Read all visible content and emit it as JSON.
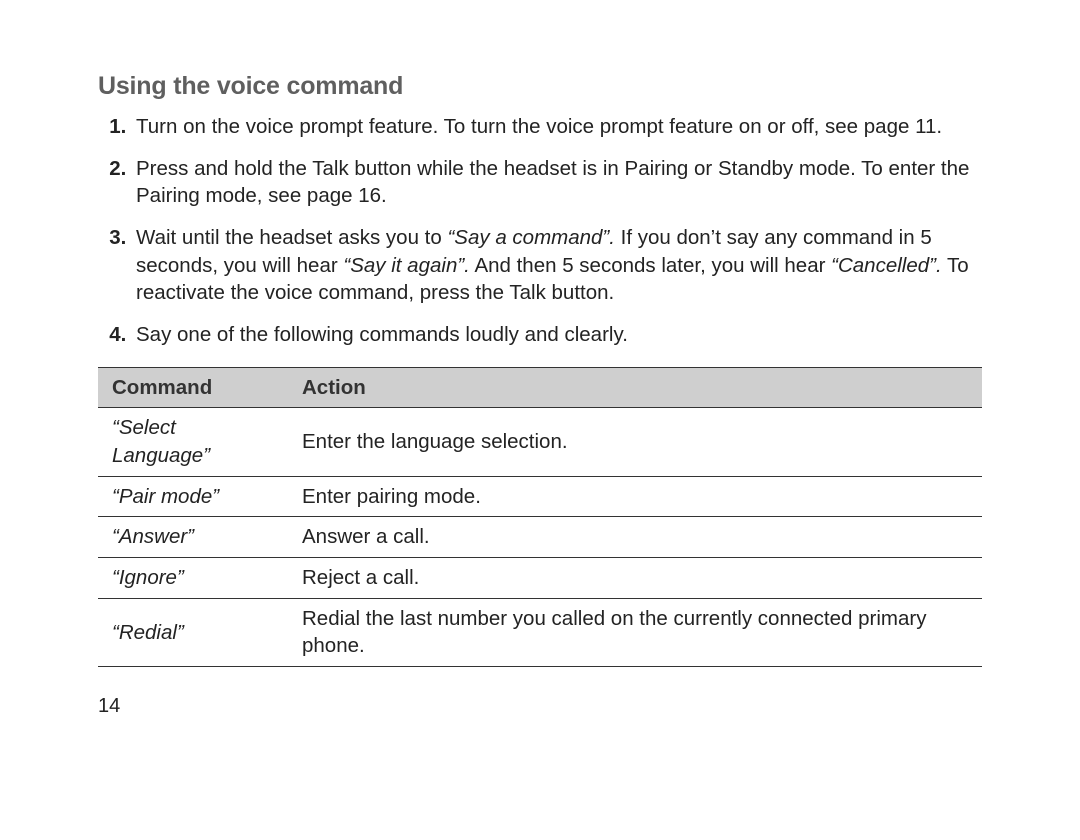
{
  "heading": "Using the voice command",
  "steps": {
    "s1": "Turn on the voice prompt feature. To turn the voice prompt feature on or off, see page 11.",
    "s2": "Press and hold the Talk button while the headset is in Pairing or Standby mode. To enter the Pairing mode, see page 16.",
    "s3_a": "Wait until the headset asks you to ",
    "s3_q1": "“Say a command”.",
    "s3_b": " If you don’t say any command in 5 seconds, you will hear ",
    "s3_q2": "“Say it again”.",
    "s3_c": " And then 5 seconds later, you will hear ",
    "s3_q3": "“Cancelled”.",
    "s3_d": " To reactivate the voice command, press the Talk button.",
    "s4": "Say one of the following commands loudly and clearly."
  },
  "table": {
    "headers": {
      "command": "Command",
      "action": "Action"
    },
    "rows": [
      {
        "command": "“Select Language”",
        "action": "Enter the language selection."
      },
      {
        "command": "“Pair mode”",
        "action": "Enter pairing mode."
      },
      {
        "command": "“Answer”",
        "action": "Answer a call."
      },
      {
        "command": "“Ignore”",
        "action": "Reject a call."
      },
      {
        "command": "“Redial”",
        "action": "Redial the last number you called on the currently connected primary phone."
      }
    ]
  },
  "page_number": "14"
}
